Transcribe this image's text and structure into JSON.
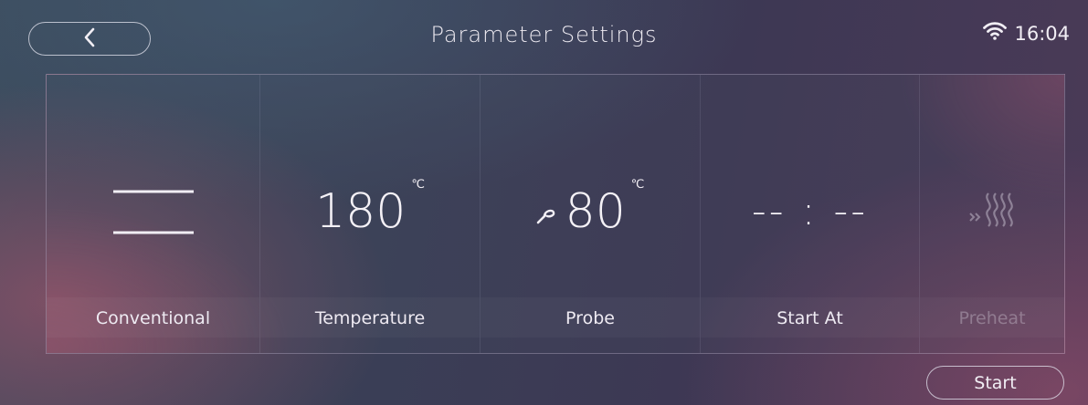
{
  "header": {
    "title": "Parameter Settings",
    "time": "16:04",
    "back_icon": "chevron-left-icon",
    "wifi_icon": "wifi-icon"
  },
  "settings": [
    {
      "id": "mode",
      "label": "Conventional",
      "icon": "conventional-heating-icon"
    },
    {
      "id": "temperature",
      "label": "Temperature",
      "value": "180",
      "unit": "℃"
    },
    {
      "id": "probe",
      "label": "Probe",
      "value": "80",
      "unit": "℃",
      "icon": "probe-icon"
    },
    {
      "id": "start_at",
      "label": "Start At",
      "value": "-- : --"
    },
    {
      "id": "preheat",
      "label": "Preheat",
      "icon": "preheat-icon",
      "disabled": true
    }
  ],
  "footer": {
    "start_label": "Start"
  },
  "colors": {
    "text": "#ece9f0",
    "disabled_text": "#6a6478"
  }
}
